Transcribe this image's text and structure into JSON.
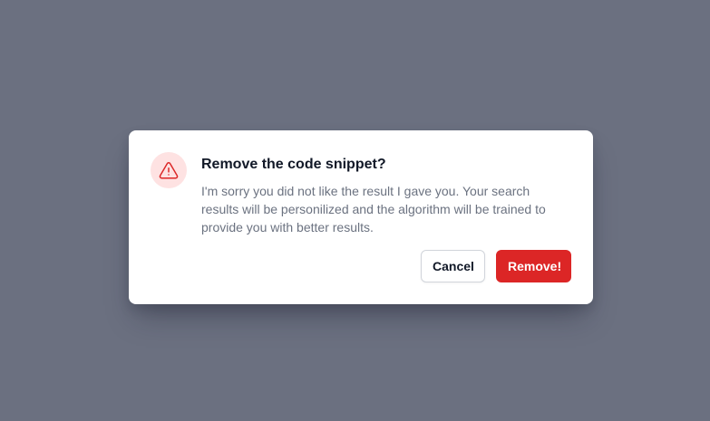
{
  "dialog": {
    "icon": "warning-triangle-icon",
    "title": "Remove the code snippet?",
    "message": "I'm sorry you did not like the result I gave you. Your search results will be personilized and the algorithm will be trained to provide you with better results.",
    "cancel_label": "Cancel",
    "confirm_label": "Remove!"
  },
  "colors": {
    "overlay": "#6b7080",
    "danger": "#dc2626",
    "icon_background": "#fee2e2"
  }
}
